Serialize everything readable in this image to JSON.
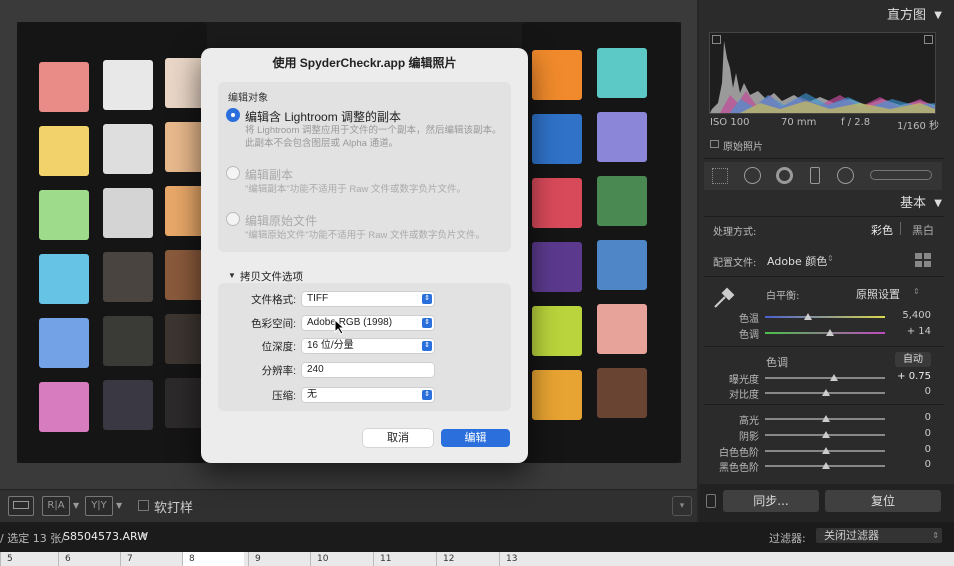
{
  "right_panel": {
    "histogram_title": "直方图",
    "exif": {
      "iso": "ISO 100",
      "focal": "70 mm",
      "aperture": "f / 2.8",
      "shutter": "1/160 秒"
    },
    "original_photo_label": "原始照片",
    "basic_title": "基本",
    "treatment_label": "处理方式:",
    "treatment_color": "彩色",
    "treatment_bw": "黑白",
    "profile_label": "配置文件:",
    "profile_value": "Adobe 颜色",
    "wb_label": "白平衡:",
    "wb_value": "原照设置",
    "temp_label": "色温",
    "temp_value": "5,400",
    "tint_label": "色调",
    "tint_value": "+ 14",
    "tone_label": "色调",
    "auto_label": "自动",
    "exposure_label": "曝光度",
    "exposure_value": "+ 0.75",
    "contrast_label": "对比度",
    "contrast_value": "0",
    "highlights_label": "高光",
    "highlights_value": "0",
    "shadows_label": "阴影",
    "shadows_value": "0",
    "whites_label": "白色色阶",
    "whites_value": "0",
    "blacks_label": "黑色色阶",
    "blacks_value": "0",
    "sync_label": "同步...",
    "reset_label": "复位"
  },
  "toolbar": {
    "ra_label": "R|A",
    "yy_label": "Y|Y",
    "softproof_label": "软打样"
  },
  "filmstrip": {
    "selection_text": "/ 选定 13 张/",
    "filename": "S8504573.ARW",
    "filter_label": "过滤器:",
    "filter_value": "关闭过滤器",
    "numbers": [
      "5",
      "6",
      "7",
      "8",
      "9",
      "10",
      "11",
      "12",
      "13"
    ]
  },
  "dialog": {
    "title": "使用 SpyderCheckr.app 编辑照片",
    "section_label": "编辑对象",
    "option1_label": "编辑含 Lightroom 调整的副本",
    "option1_desc_line1": "将 Lightroom 调整应用于文件的一个副本，然后编辑该副本。",
    "option1_desc_line2": "此副本不会包含图层或 Alpha 通道。",
    "option2_label": "编辑副本",
    "option2_desc": "\"编辑副本\"功能不适用于 Raw 文件或数字负片文件。",
    "option3_label": "编辑原始文件",
    "option3_desc": "\"编辑原始文件\"功能不适用于 Raw 文件或数字负片文件。",
    "copy_options_label": "拷贝文件选项",
    "file_format_label": "文件格式:",
    "file_format_value": "TIFF",
    "color_space_label": "色彩空间:",
    "color_space_value": "Adobe RGB (1998)",
    "bit_depth_label": "位深度:",
    "bit_depth_value": "16 位/分量",
    "resolution_label": "分辨率:",
    "resolution_value": "240",
    "compression_label": "压缩:",
    "compression_value": "无",
    "cancel_label": "取消",
    "edit_label": "编辑"
  },
  "colors": {
    "accent": "#2a6fdc",
    "panel_bg": "#2b2b2b"
  }
}
